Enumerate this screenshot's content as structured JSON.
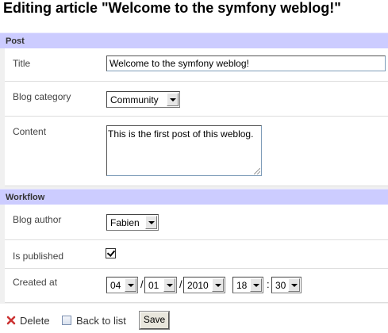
{
  "page": {
    "title": "Editing article \"Welcome to the symfony weblog!\""
  },
  "post_section": {
    "header": "Post",
    "title_label": "Title",
    "title_value": "Welcome to the symfony weblog!",
    "category_label": "Blog category",
    "category_value": "Community",
    "content_label": "Content",
    "content_value": "This is the first post of this weblog."
  },
  "workflow_section": {
    "header": "Workflow",
    "author_label": "Blog author",
    "author_value": "Fabien",
    "published_label": "Is published",
    "published_checked": true,
    "created_label": "Created at",
    "created_at": {
      "month": "04",
      "day": "01",
      "year": "2010",
      "hour": "18",
      "minute": "30",
      "date_separator": "/",
      "time_separator": ":"
    }
  },
  "actions": {
    "delete_label": "Delete",
    "back_label": "Back to list",
    "save_label": "Save"
  },
  "icons": {
    "delete": "delete-x-icon",
    "back": "list-icon",
    "check": "check-icon",
    "dropdown": "chevron-down-icon"
  },
  "colors": {
    "section_header": "#ccccff",
    "form_background": "#f0f0f0",
    "delete_icon": "#cc3333"
  }
}
